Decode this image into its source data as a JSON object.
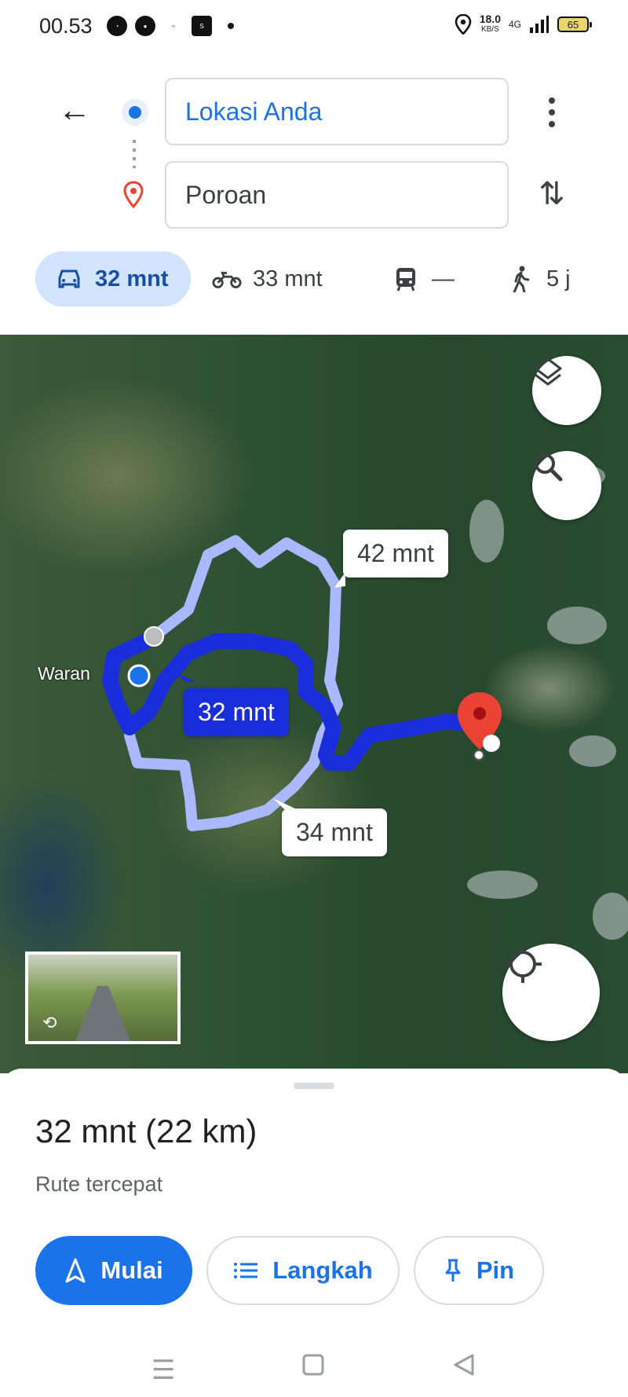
{
  "status_bar": {
    "time": "00.53",
    "speed_value": "18.0",
    "speed_unit": "KB/S",
    "network": "4G",
    "battery": "65"
  },
  "search": {
    "origin": "Lokasi Anda",
    "destination": "Poroan"
  },
  "modes": [
    {
      "icon": "car-icon",
      "label": "32 mnt"
    },
    {
      "icon": "motorcycle-icon",
      "label": "33 mnt"
    },
    {
      "icon": "transit-icon",
      "label": "—"
    },
    {
      "icon": "walk-icon",
      "label": "5 j"
    }
  ],
  "map": {
    "place_label": "Waran",
    "routes": [
      {
        "label": "42 mnt",
        "selected": false
      },
      {
        "label": "32 mnt",
        "selected": true
      },
      {
        "label": "34 mnt",
        "selected": false
      }
    ],
    "colors": {
      "selected_route": "#1a2ddb",
      "alternate_route": "#aab8ff",
      "destination_pin": "#ea4335"
    }
  },
  "sheet": {
    "summary": "32 mnt (22 km)",
    "subtitle": "Rute tercepat",
    "start_label": "Mulai",
    "steps_label": "Langkah",
    "pin_label": "Pin"
  },
  "theme": {
    "accent": "#1a73e8",
    "active_chip_bg": "#d2e3fc"
  }
}
